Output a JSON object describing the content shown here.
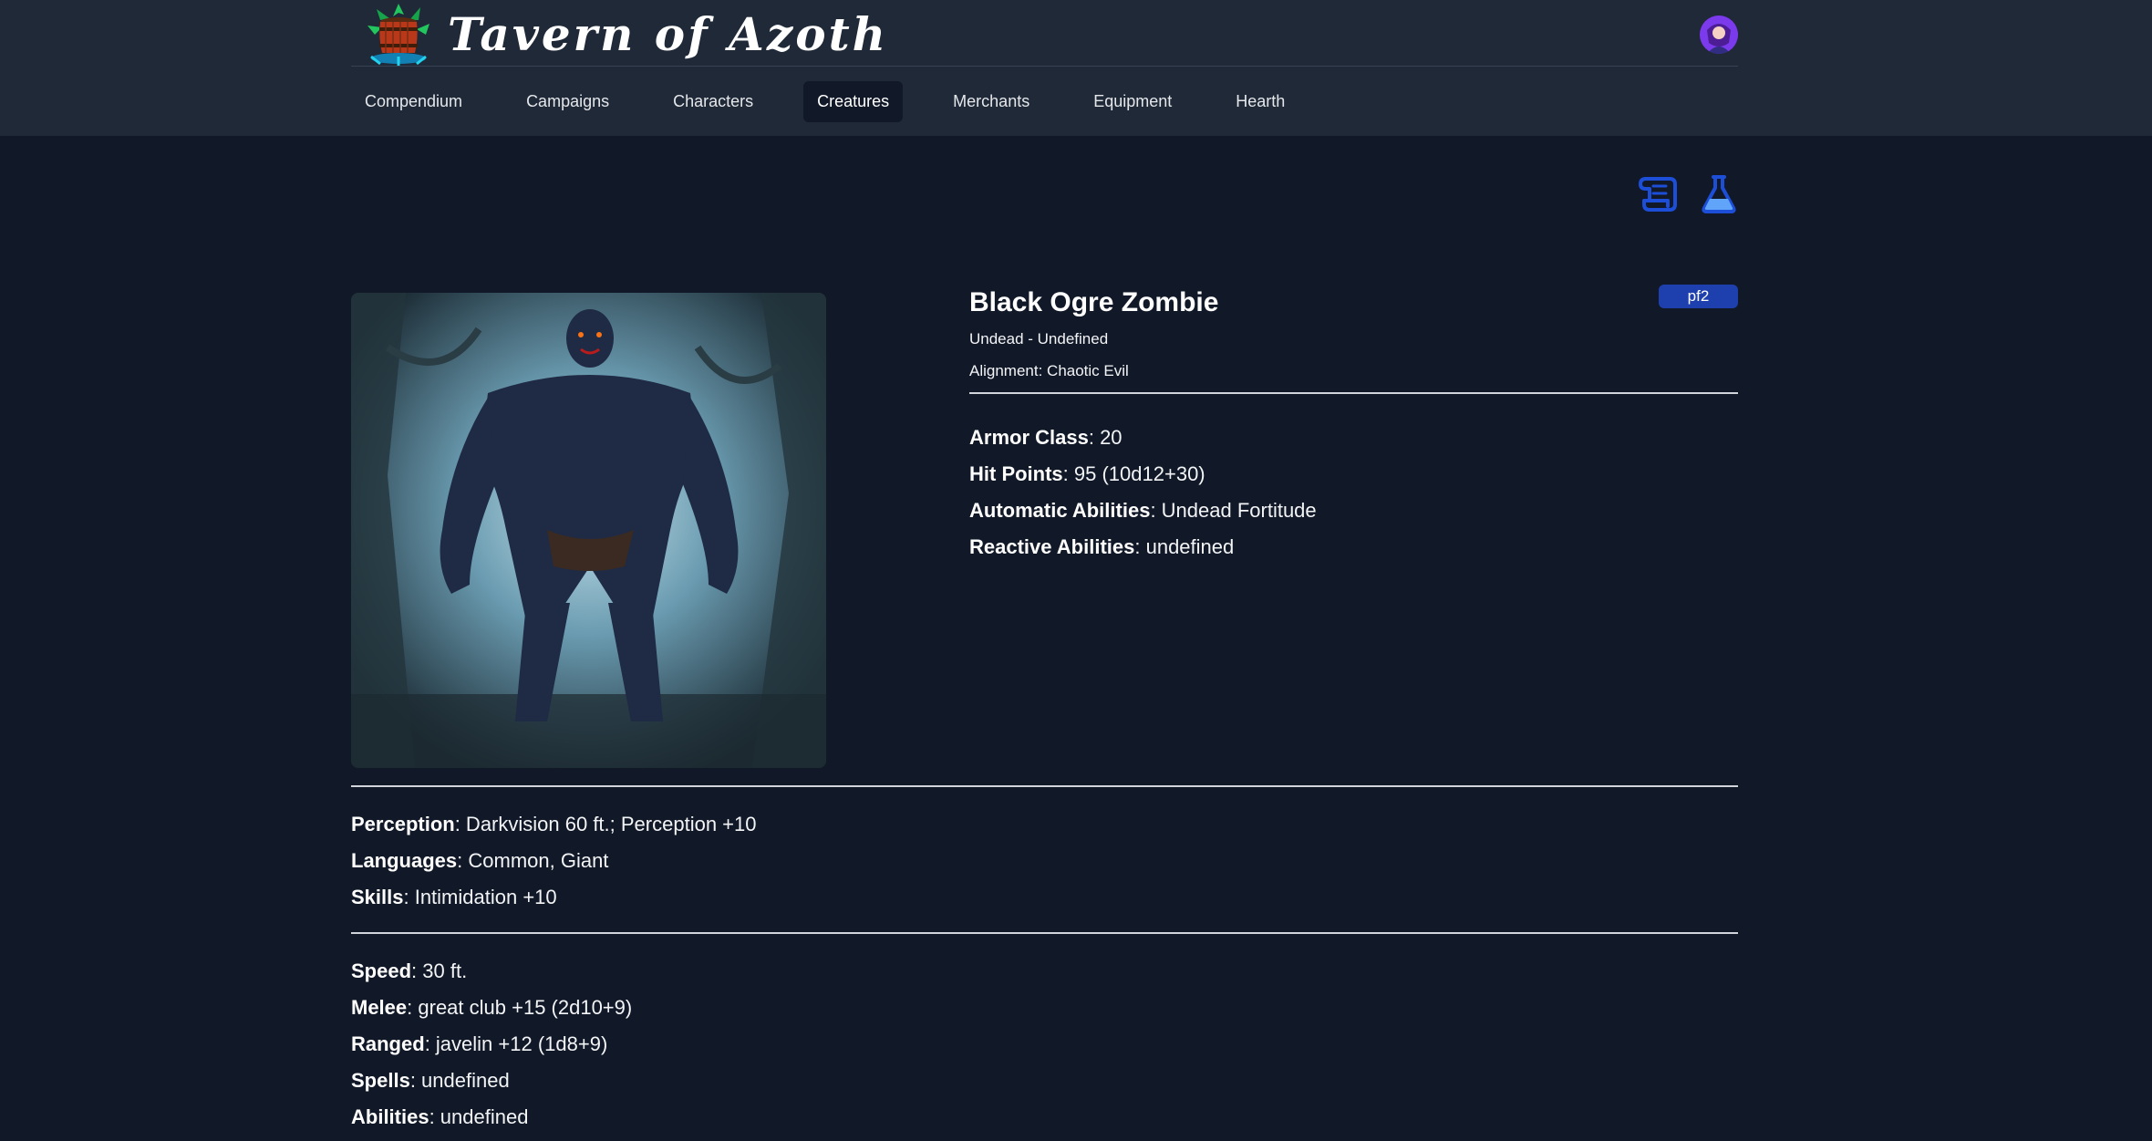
{
  "app": {
    "title": "Tavern of Azoth"
  },
  "nav": {
    "items": [
      {
        "label": "Compendium",
        "active": false
      },
      {
        "label": "Campaigns",
        "active": false
      },
      {
        "label": "Characters",
        "active": false
      },
      {
        "label": "Creatures",
        "active": true
      },
      {
        "label": "Merchants",
        "active": false
      },
      {
        "label": "Equipment",
        "active": false
      },
      {
        "label": "Hearth",
        "active": false
      }
    ]
  },
  "toolbar": {
    "icons": [
      "scroll-icon",
      "flask-icon"
    ],
    "accent_color": "#1d4ed8"
  },
  "creature": {
    "name": "Black Ogre Zombie",
    "system_badge": "pf2",
    "type_line": "Undead - Undefined",
    "alignment_line": "Alignment: Chaotic Evil",
    "primary_stats": [
      {
        "label": "Armor Class",
        "value": ": 20"
      },
      {
        "label": "Hit Points",
        "value": ": 95 (10d12+30)"
      },
      {
        "label": "Automatic Abilities",
        "value": ": Undead Fortitude"
      },
      {
        "label": "Reactive Abilities",
        "value": ": undefined"
      }
    ],
    "sense_stats": [
      {
        "label": "Perception",
        "value": ": Darkvision 60 ft.; Perception +10"
      },
      {
        "label": "Languages",
        "value": ": Common, Giant"
      },
      {
        "label": "Skills",
        "value": ": Intimidation +10"
      }
    ],
    "combat_stats": [
      {
        "label": "Speed",
        "value": ": 30 ft."
      },
      {
        "label": "Melee",
        "value": ": great club +15 (2d10+9)"
      },
      {
        "label": "Ranged",
        "value": ": javelin +12 (1d8+9)"
      },
      {
        "label": "Spells",
        "value": ": undefined"
      },
      {
        "label": "Abilities",
        "value": ": undefined"
      }
    ]
  },
  "colors": {
    "background": "#111827",
    "header": "#1f2937",
    "badge": "#1e40af"
  }
}
